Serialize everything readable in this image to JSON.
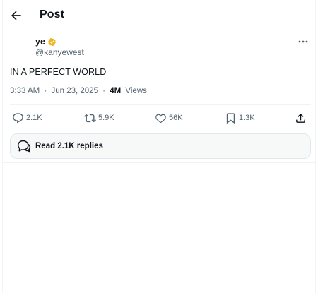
{
  "header": {
    "title": "Post"
  },
  "author": {
    "display_name": "ye",
    "handle": "@kanyewest",
    "verified_color": "#e8b829"
  },
  "post": {
    "text": "IN A PERFECT WORLD"
  },
  "meta": {
    "time": "3:33 AM",
    "separator": "·",
    "date": "Jun 23, 2025",
    "views_count": "4M",
    "views_label": "Views"
  },
  "actions": [
    {
      "icon": "reply-icon",
      "count": "2.1K"
    },
    {
      "icon": "repost-icon",
      "count": "5.9K"
    },
    {
      "icon": "like-icon",
      "count": "56K"
    },
    {
      "icon": "bookmark-icon",
      "count": "1.3K"
    },
    {
      "icon": "share-icon",
      "count": ""
    }
  ],
  "replies": {
    "label": "Read 2.1K replies"
  },
  "colors": {
    "text": "#0f1419",
    "secondary": "#536471",
    "border": "#eff3f4"
  }
}
